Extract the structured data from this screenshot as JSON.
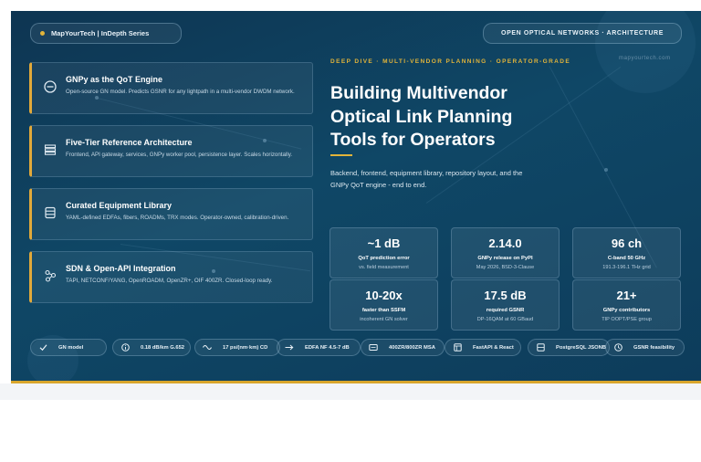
{
  "brand": {
    "label": "MapYourTech | InDepth Series"
  },
  "topic": {
    "label": "OPEN OPTICAL NETWORKS · ARCHITECTURE"
  },
  "watermark": "mapyourtech.com",
  "cards": [
    {
      "title": "GNPy as the QoT Engine",
      "desc": "Open-source GN model. Predicts GSNR for any lightpath in a multi-vendor DWDM network.",
      "icon": "circle-line-icon"
    },
    {
      "title": "Five-Tier Reference Architecture",
      "desc": "Frontend, API gateway, services, GNPy worker pool, persistence layer. Scales horizontally.",
      "icon": "layers-icon"
    },
    {
      "title": "Curated Equipment Library",
      "desc": "YAML-defined EDFAs, fibers, ROADMs, TRX modes. Operator-owned, calibration-driven.",
      "icon": "database-icon"
    },
    {
      "title": "SDN & Open-API Integration",
      "desc": "TAPI, NETCONF/YANG, OpenROADM, OpenZR+, OIF 400ZR. Closed-loop ready.",
      "icon": "network-nodes-icon"
    }
  ],
  "hero": {
    "kicker": "DEEP DIVE · MULTI-VENDOR PLANNING · OPERATOR-GRADE",
    "title_line1": "Building Multivendor",
    "title_line2": "Optical Link Planning",
    "title_line3": "Tools for Operators",
    "subtitle": "Backend, frontend, equipment library, repository layout, and the GNPy QoT engine - end to end."
  },
  "stats": [
    {
      "value": "~1 dB",
      "label": "QoT prediction error",
      "sub": "vs. field measurement"
    },
    {
      "value": "2.14.0",
      "label": "GNPy release on PyPI",
      "sub": "May 2026, BSD-3-Clause"
    },
    {
      "value": "96 ch",
      "label": "C-band 50 GHz",
      "sub": "191.3-196.1 THz grid"
    },
    {
      "value": "10-20x",
      "label": "faster than SSFM",
      "sub": "incoherent GN solver"
    },
    {
      "value": "17.5 dB",
      "label": "required GSNR",
      "sub": "DP-16QAM at 60 GBaud"
    },
    {
      "value": "21+",
      "label": "GNPy contributors",
      "sub": "TIP OOPT/PSE group"
    }
  ],
  "chips": [
    {
      "label": "GN model",
      "icon": "check-icon"
    },
    {
      "label": "0.18 dB/km G.652",
      "icon": "info-icon"
    },
    {
      "label": "17 ps/(nm·km) CD",
      "icon": "wave-icon"
    },
    {
      "label": "EDFA NF 4.5-7 dB",
      "icon": "arrow-right-icon"
    },
    {
      "label": "400ZR/800ZR MSA",
      "icon": "module-icon"
    },
    {
      "label": "FastAPI & React",
      "icon": "window-icon"
    },
    {
      "label": "PostgreSQL JSONB",
      "icon": "storage-icon"
    },
    {
      "label": "GSNR feasibility",
      "icon": "clock-icon"
    }
  ],
  "colors": {
    "background": "#0f4766",
    "accent": "#e2b43a",
    "card_border": "#e2a93a"
  }
}
